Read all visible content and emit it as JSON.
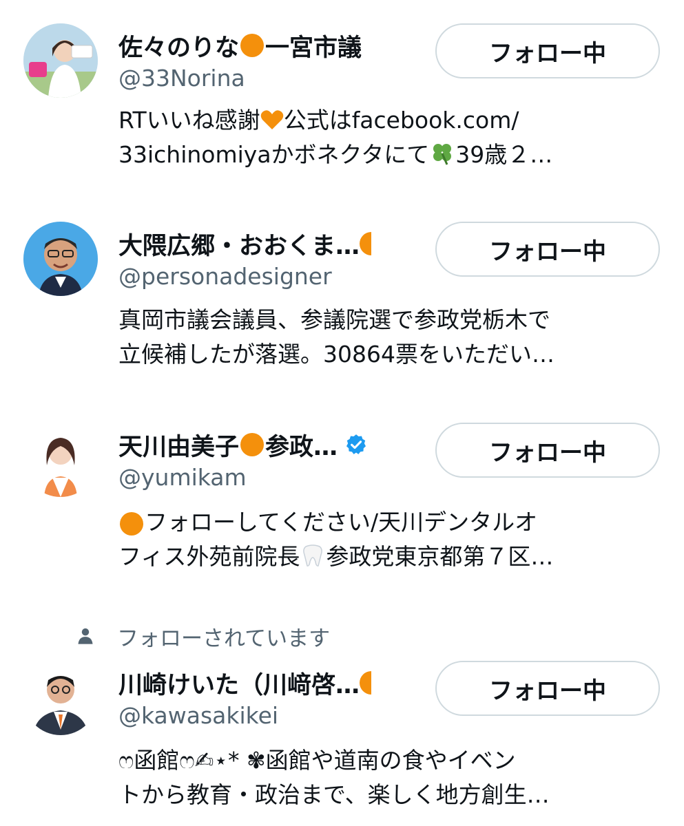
{
  "users": [
    {
      "name": "佐々のりな",
      "name_suffix": "一宮市議",
      "handle": "@33Norina",
      "follow_label": "フォロー中",
      "bio_line1_a": "RTいいね感謝",
      "bio_line1_b": "公式はfacebook.com/",
      "bio_line2_a": "33ichinomiyaかボネクタにて",
      "bio_line2_b": "39歳２…",
      "avatar": "woman-photo-avatar"
    },
    {
      "name": "大隈広郷・おおくま…",
      "handle": "@personadesigner",
      "follow_label": "フォロー中",
      "bio_line1": "真岡市議会議員、参議院選で参政党栃木で",
      "bio_line2": "立候補したが落選。30864票をいただい…",
      "avatar": "man-glasses-avatar"
    },
    {
      "name": "天川由美子",
      "name_suffix": "参政…",
      "handle": "@yumikam",
      "follow_label": "フォロー中",
      "bio_line1": "フォローしてください/天川デンタルオ",
      "bio_line2_a": "フィス外苑前院長",
      "bio_line2_b": "参政党東京都第７区…",
      "avatar": "woman-dentist-avatar"
    },
    {
      "social_context": "フォローされています",
      "name": "川崎けいた（川﨑啓…",
      "handle": "@kawasakikei",
      "follow_label": "フォロー中",
      "bio_line1_a": "ෆ函館ෆ",
      "bio_line1_b": "✍︎⋆* ✾函館や道南の食やイベン",
      "bio_line2": "トから教育・政治まで、楽しく地方創生…",
      "avatar": "man-suit-avatar"
    }
  ],
  "colors": {
    "text_primary": "#0f1419",
    "text_secondary": "#536471",
    "border": "#cfd9de",
    "orange": "#f4900c",
    "verified": "#1d9bf0"
  }
}
